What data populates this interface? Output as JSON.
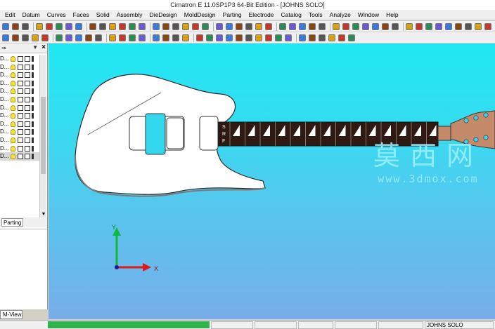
{
  "window": {
    "title": "Cimatron E 11.0SP1P3 64-Bit Edition - [JOHNS SOLO]"
  },
  "menu": {
    "items": [
      {
        "label": "Edit"
      },
      {
        "label": "Datum"
      },
      {
        "label": "Curves"
      },
      {
        "label": "Faces"
      },
      {
        "label": "Solid"
      },
      {
        "label": "Assembly"
      },
      {
        "label": "DieDesign"
      },
      {
        "label": "MoldDesign"
      },
      {
        "label": "Parting"
      },
      {
        "label": "Electrode"
      },
      {
        "label": "Catalog"
      },
      {
        "label": "Tools"
      },
      {
        "label": "Analyze"
      },
      {
        "label": "Window"
      },
      {
        "label": "Help"
      }
    ]
  },
  "left_panel": {
    "rows": [
      {
        "label": "D..."
      },
      {
        "label": "D..."
      },
      {
        "label": "D..."
      },
      {
        "label": "D..."
      },
      {
        "label": "D..."
      },
      {
        "label": "D..."
      },
      {
        "label": "D..."
      },
      {
        "label": "D..."
      },
      {
        "label": "D..."
      },
      {
        "label": "D..."
      },
      {
        "label": "D..."
      },
      {
        "label": "D..."
      },
      {
        "label": "D..."
      }
    ],
    "tab_parting": "Parting",
    "tab_mview": "M-View"
  },
  "viewport": {
    "axis_x_label": "X",
    "axis_y_label": "Y",
    "watermark_cn": "莫西网",
    "watermark_url": "www.3dmox.com",
    "fretboard_labels": [
      "S",
      "R",
      "F"
    ]
  },
  "status": {
    "document": "JOHNS SOLO"
  },
  "colors": {
    "viewport_top": "#1fe8f3",
    "viewport_bottom": "#77ade9",
    "fretboard": "#2e1a12",
    "headstock": "#c48a6a",
    "pickup_highlight": "#34d8ee",
    "axis_x": "#e01818",
    "axis_y": "#12b83a",
    "status_progress": "#2fb34a"
  }
}
